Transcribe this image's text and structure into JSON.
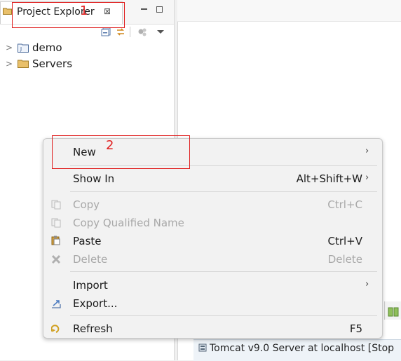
{
  "explorer": {
    "tab_label": "Project Explorer",
    "tab_close": "⊠",
    "tree": [
      {
        "label": "demo",
        "twisty": ">"
      },
      {
        "label": "Servers",
        "twisty": ">"
      }
    ]
  },
  "annotations": {
    "one": "1",
    "two": "2"
  },
  "context_menu": {
    "new": {
      "label": "New",
      "arrow": "›"
    },
    "show_in": {
      "label": "Show In",
      "shortcut": "Alt+Shift+W",
      "arrow": "›"
    },
    "copy": {
      "label": "Copy",
      "shortcut": "Ctrl+C"
    },
    "copy_qualified": {
      "label": "Copy Qualified Name"
    },
    "paste": {
      "label": "Paste",
      "shortcut": "Ctrl+V"
    },
    "delete": {
      "label": "Delete",
      "shortcut": "Delete"
    },
    "import": {
      "label": "Import",
      "arrow": "›"
    },
    "export": {
      "label": "Export..."
    },
    "refresh": {
      "label": "Refresh",
      "shortcut": "F5"
    }
  },
  "servers_panel": {
    "entry": "Tomcat v9.0 Server at localhost [Stop"
  },
  "colors": {
    "annotation": "#e02020",
    "menu_bg": "#f2f2f2",
    "disabled_text": "#a8a8a8"
  }
}
